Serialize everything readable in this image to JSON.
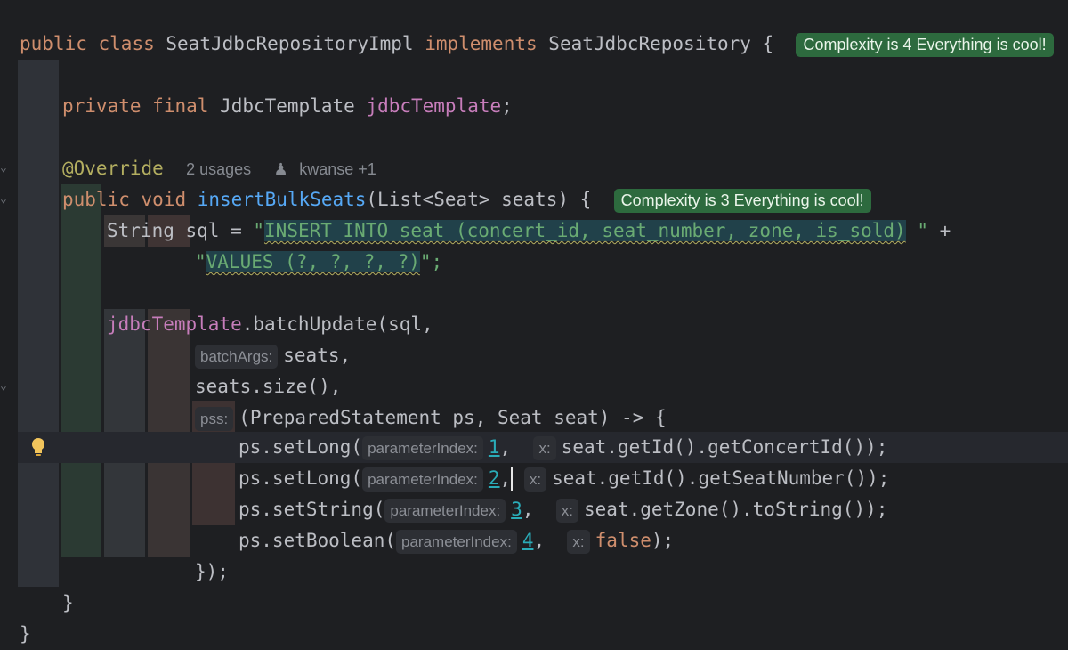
{
  "class_decl": {
    "kw_public": "public",
    "kw_class": "class",
    "name": "SeatJdbcRepositoryImpl",
    "kw_implements": "implements",
    "iface": "SeatJdbcRepository",
    "brace": "{",
    "badge": "Complexity is 4 Everything is cool!"
  },
  "field_line": {
    "kw_private": "private",
    "kw_final": "final",
    "type": "JdbcTemplate",
    "name": "jdbcTemplate",
    "semi": ";"
  },
  "annotation_line": {
    "annotation": "@Override",
    "usages": "2 usages",
    "author_icon": "person-icon",
    "author": "kwanse +1"
  },
  "method_decl": {
    "kw_public": "public",
    "kw_void": "void",
    "name": "insertBulkSeats",
    "params": "(List<Seat> seats) {",
    "badge": "Complexity is 3 Everything is cool!"
  },
  "sql_line1": {
    "prefix": "String sql = ",
    "quote_open": "\"",
    "sql": "INSERT INTO seat (concert_id, seat_number, zone, is_sold)",
    "tail": " \"",
    "plus": " +"
  },
  "sql_line2": {
    "quote_open": "\"",
    "sql": "VALUES (?, ?, ?, ?)",
    "tail": "\";"
  },
  "batch_line": {
    "field": "jdbcTemplate",
    "rest": ".batchUpdate(sql,"
  },
  "args_line": {
    "hint": "batchArgs:",
    "code": "seats,"
  },
  "size_line": {
    "code": "seats.size(),"
  },
  "pss_line": {
    "hint": "pss:",
    "code": "(PreparedStatement ps, Seat seat) -> {"
  },
  "set_lines": [
    {
      "call": "ps.setLong(",
      "hint1": "parameterIndex:",
      "index": "1",
      "sep": ",",
      "hint2": "x:",
      "value": "seat.getId().getConcertId());",
      "value_kw": ""
    },
    {
      "call": "ps.setLong(",
      "hint1": "parameterIndex:",
      "index": "2",
      "sep": ",",
      "hint2": "x:",
      "value": "seat.getId().getSeatNumber());",
      "value_kw": ""
    },
    {
      "call": "ps.setString(",
      "hint1": "parameterIndex:",
      "index": "3",
      "sep": ",",
      "hint2": "x:",
      "value": "seat.getZone().toString());",
      "value_kw": ""
    },
    {
      "call": "ps.setBoolean(",
      "hint1": "parameterIndex:",
      "index": "4",
      "sep": ",",
      "hint2": "x:",
      "value": ");",
      "value_kw": "false"
    }
  ],
  "close_lambda": "});",
  "close_method": "}",
  "close_class": "}",
  "gutter_icons": {
    "intention": "lightbulb-icon",
    "fold": "chevron-down-icon"
  },
  "colors": {
    "background": "#1e1f22",
    "keyword": "#cf8e6d",
    "method": "#56a8f5",
    "field": "#c77dbb",
    "annotation": "#b3ae60",
    "string": "#6aab73",
    "number": "#2aacb8",
    "badge_bg": "#2d6a3e"
  }
}
